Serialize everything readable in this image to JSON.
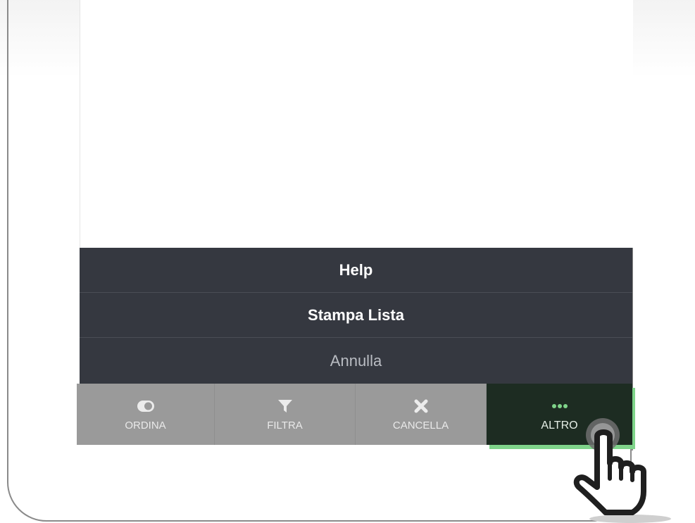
{
  "action_sheet": {
    "items": [
      {
        "label": "Help"
      },
      {
        "label": "Stampa Lista"
      }
    ],
    "cancel_label": "Annulla"
  },
  "toolbar": {
    "items": [
      {
        "label": "ORDINA",
        "icon": "toggle-icon"
      },
      {
        "label": "FILTRA",
        "icon": "filter-icon"
      },
      {
        "label": "CANCELLA",
        "icon": "close-icon"
      },
      {
        "label": "ALTRO",
        "icon": "more-dots-icon",
        "active": true
      }
    ]
  },
  "colors": {
    "sheet_bg": "#353840",
    "toolbar_bg": "#9a9a9a",
    "active_bg": "#1d2c22",
    "active_accent": "#7fd48a"
  }
}
